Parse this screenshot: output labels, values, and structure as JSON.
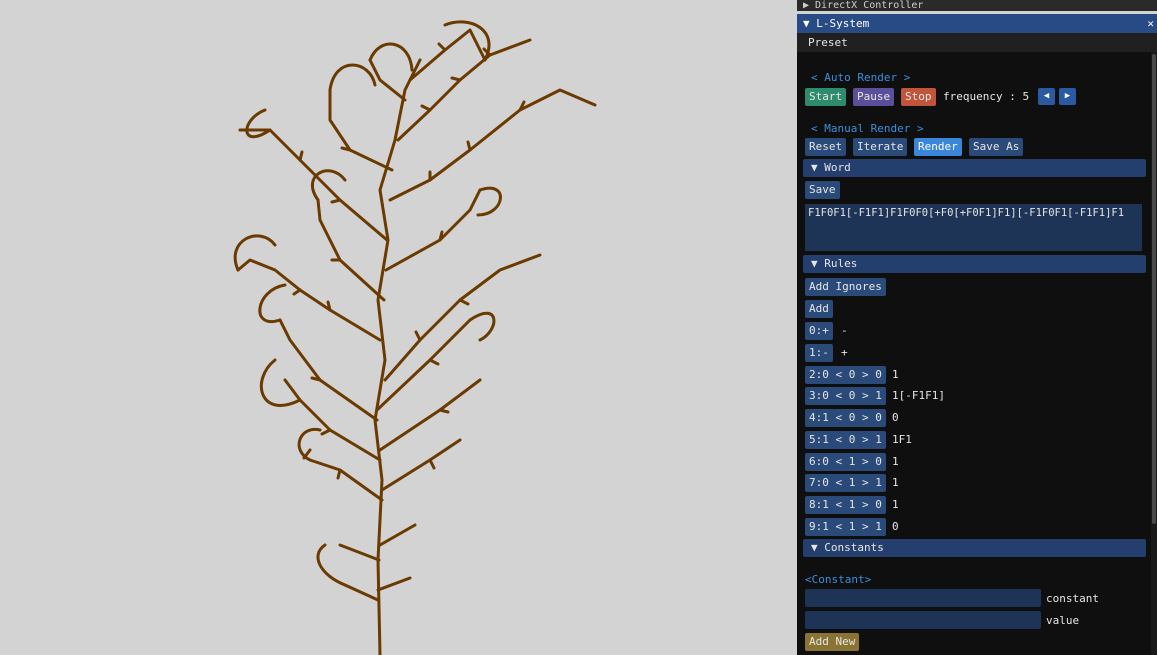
{
  "windows": {
    "directx_title": "▶ DirectX Controller",
    "lsystem_title": "▼ L-System",
    "close_glyph": "✕"
  },
  "menu": {
    "preset": "Preset"
  },
  "auto_render": {
    "label": "< Auto Render >",
    "start": "Start",
    "pause": "Pause",
    "stop": "Stop",
    "frequency_label": "frequency : 5"
  },
  "manual_render": {
    "label": "< Manual Render >",
    "reset": "Reset",
    "iterate": "Iterate",
    "render": "Render",
    "save_as": "Save As"
  },
  "word": {
    "header": "▼  Word",
    "save": "Save",
    "value": "F1F0F1[-F1F1]F1F0F0[+F0[+F0F1]F1][-F1F0F1[-F1F1]F1"
  },
  "rules": {
    "header": "▼  Rules",
    "add_ignores": "Add Ignores",
    "add": "Add",
    "items": [
      {
        "key": "0:+",
        "value": "-"
      },
      {
        "key": "1:-",
        "value": "+"
      },
      {
        "key": "2:0 < 0 > 0",
        "value": "1"
      },
      {
        "key": "3:0 < 0 > 1",
        "value": "1[-F1F1]"
      },
      {
        "key": "4:1 < 0 > 0",
        "value": "0"
      },
      {
        "key": "5:1 < 0 > 1",
        "value": "1F1"
      },
      {
        "key": "6:0 < 1 > 0",
        "value": "1"
      },
      {
        "key": "7:0 < 1 > 1",
        "value": "1"
      },
      {
        "key": "8:1 < 1 > 0",
        "value": "1"
      },
      {
        "key": "9:1 < 1 > 1",
        "value": "0"
      }
    ]
  },
  "constants": {
    "header": "▼  Constants",
    "section_label": "<Constant>",
    "constant_label": "constant",
    "value_label": "value",
    "add_new": "Add New"
  },
  "colors": {
    "plant": "#6b3a00",
    "background": "#d3d3d3",
    "panel": "#0f0f0f",
    "accent": "#3a86d8"
  }
}
